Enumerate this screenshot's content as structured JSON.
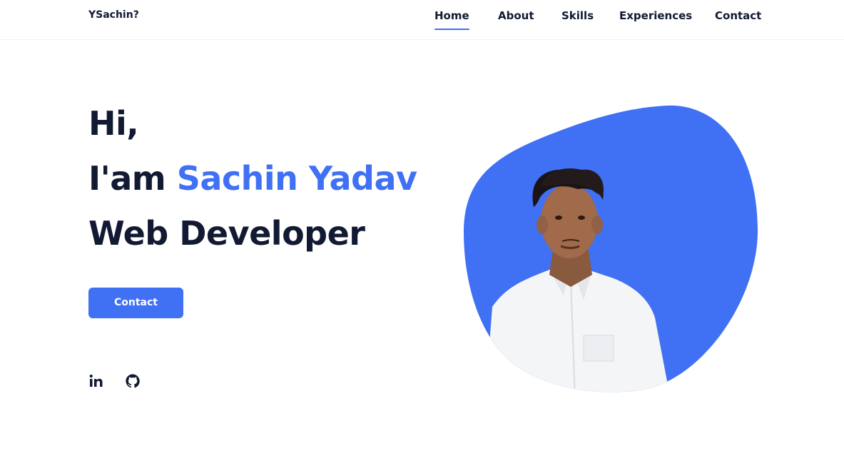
{
  "header": {
    "logo": "YSachin?",
    "nav": [
      {
        "label": "Home",
        "active": true
      },
      {
        "label": "About",
        "active": false
      },
      {
        "label": "Skills",
        "active": false
      },
      {
        "label": "Experiences",
        "active": false
      },
      {
        "label": "Contact",
        "active": false
      }
    ]
  },
  "hero": {
    "greeting": "Hi,",
    "intro_prefix": "I'am ",
    "name": "Sachin Yadav",
    "role": "Web Developer",
    "cta_label": "Contact"
  },
  "social": [
    {
      "icon": "linkedin-icon"
    },
    {
      "icon": "github-icon"
    }
  ],
  "colors": {
    "accent": "#4070f4",
    "text": "#121a33",
    "background": "#ffffff"
  }
}
